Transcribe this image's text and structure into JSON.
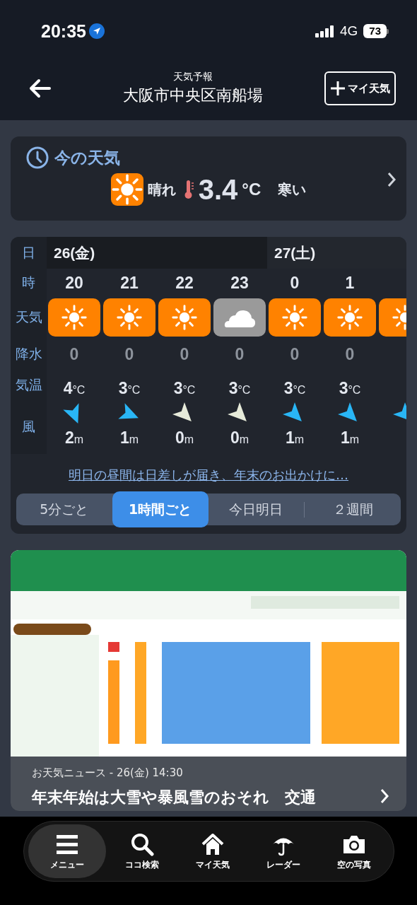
{
  "status_bar": {
    "time": "20:35",
    "network": "4G",
    "battery": "73"
  },
  "header": {
    "subtitle": "天気予報",
    "title": "大阪市中央区南船場",
    "my_weather_button": "マイ天気"
  },
  "current": {
    "heading": "今の天気",
    "icon": {
      "kind": "sunny"
    },
    "condition_label": "晴れ",
    "temperature": "3.4",
    "unit": "°C",
    "feeling": "寒い"
  },
  "forecast": {
    "row_labels": [
      "日",
      "時",
      "天気",
      "降水",
      "気温",
      "風"
    ],
    "days": [
      {
        "label": "26(金)",
        "hours": [
          {
            "hour": "20",
            "kind": "sunny",
            "precip": "0",
            "temp": "4",
            "temp_unit": "°C",
            "wind_arrow": {
              "kind": "sse",
              "color": "#29b6f6"
            },
            "wind": "2",
            "wind_unit": "m"
          },
          {
            "hour": "21",
            "kind": "sunny",
            "precip": "0",
            "temp": "3",
            "temp_unit": "°C",
            "wind_arrow": {
              "kind": "ese",
              "color": "#29b6f6"
            },
            "wind": "1",
            "wind_unit": "m"
          },
          {
            "hour": "22",
            "kind": "sunny",
            "precip": "0",
            "temp": "3",
            "temp_unit": "°C",
            "wind_arrow": {
              "kind": "se",
              "color": "#e6ead9"
            },
            "wind": "0",
            "wind_unit": "m"
          },
          {
            "hour": "23",
            "kind": "cloudy",
            "precip": "0",
            "temp": "3",
            "temp_unit": "°C",
            "wind_arrow": {
              "kind": "se",
              "color": "#e6ead9"
            },
            "wind": "0",
            "wind_unit": "m"
          }
        ]
      },
      {
        "label": "27(土)",
        "hours": [
          {
            "hour": "0",
            "kind": "sunny",
            "precip": "0",
            "temp": "3",
            "temp_unit": "°C",
            "wind_arrow": {
              "kind": "se",
              "color": "#29b6f6"
            },
            "wind": "1",
            "wind_unit": "m"
          },
          {
            "hour": "1",
            "kind": "sunny",
            "precip": "0",
            "temp": "3",
            "temp_unit": "°C",
            "wind_arrow": {
              "kind": "se",
              "color": "#29b6f6"
            },
            "wind": "1",
            "wind_unit": "m"
          },
          {
            "kind": "sunny",
            "wind_arrow": {
              "kind": "se",
              "color": "#29b6f6"
            }
          }
        ]
      }
    ],
    "summary_link": "明日の昼間は日差しが届き、年末のお出かけに…",
    "tabs": [
      {
        "label": "5分ごと",
        "selected": false
      },
      {
        "label": "1時間ごと",
        "selected": true
      },
      {
        "label": "今日明日",
        "selected": false
      },
      {
        "label": "２週間",
        "selected": false
      }
    ]
  },
  "news": {
    "meta": "お天気ニュース - 26(金) 14:30",
    "title": "年末年始は大雪や暴風雪のおそれ　交通"
  },
  "bottom_nav": [
    {
      "kind": "menu",
      "label": "メニュー",
      "selected": true
    },
    {
      "kind": "search",
      "label": "ココ検索",
      "selected": false
    },
    {
      "kind": "home",
      "label": "マイ天気",
      "selected": false
    },
    {
      "kind": "radar",
      "label": "レーダー",
      "selected": false
    },
    {
      "kind": "camera",
      "label": "空の写真",
      "selected": false
    }
  ]
}
